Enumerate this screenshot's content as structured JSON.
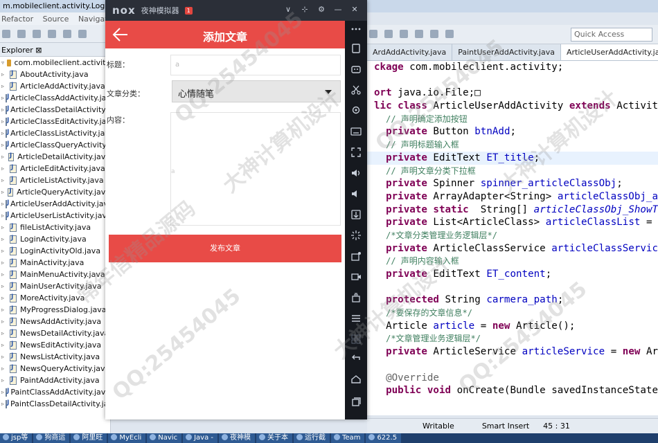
{
  "eclipse": {
    "title": "m.mobileclient.activity.LoginActi",
    "menu": [
      "Refactor",
      "Source",
      "Navigate"
    ],
    "quick_access": "Quick Access",
    "explorer_tab": "Explorer",
    "package": "com.mobileclient.activity",
    "files": [
      "AboutActivity.java",
      "ArticleAddActivity.java",
      "ArticleClassAddActivity.java",
      "ArticleClassDetailActivity.java",
      "ArticleClassEditActivity.java",
      "ArticleClassListActivity.java",
      "ArticleClassQueryActivity.java",
      "ArticleDetailActivity.java",
      "ArticleEditActivity.java",
      "ArticleListActivity.java",
      "ArticleQueryActivity.java",
      "ArticleUserAddActivity.java",
      "ArticleUserListActivity.java",
      "fileListActivity.java",
      "LoginActivity.java",
      "LoginActivityOld.java",
      "MainActivity.java",
      "MainMenuActivity.java",
      "MainUserActivity.java",
      "MoreActivity.java",
      "MyProgressDialog.java",
      "NewsAddActivity.java",
      "NewsDetailActivity.java",
      "NewsEditActivity.java",
      "NewsListActivity.java",
      "NewsQueryActivity.java",
      "PaintAddActivity.java",
      "PaintClassAddActivity.java",
      "PaintClassDetailActivity.java"
    ],
    "editor_tabs": [
      "ArdAddActivity.java",
      "PaintUserAddActivity.java",
      "ArticleUserAddActivity.java"
    ],
    "status": {
      "writable": "Writable",
      "insert": "Smart Insert",
      "position": "45 : 31"
    },
    "taskbar": [
      "jsp等",
      "狗商运",
      "阿里旺",
      "MyEcli",
      "Navic",
      "Java -",
      "夜神模",
      "关于本",
      "运行截",
      "Team",
      "622.5"
    ]
  },
  "emulator": {
    "brand": "nox",
    "name": "夜神模拟器",
    "badge": "1",
    "controls": [
      "∨",
      "⊹",
      "⚙",
      "—",
      "✕"
    ]
  },
  "app": {
    "title": "添加文章",
    "title_label": "标题：",
    "title_placeholder": "a",
    "class_label": "文章分类：",
    "class_value": "心情随笔",
    "content_label": "内容：",
    "content_placeholder": "a",
    "publish_label": "发布文章"
  },
  "watermark": {
    "text1": "QQ:25454045",
    "text2": "大神计算机设计",
    "text3": "常年信精品源码"
  }
}
